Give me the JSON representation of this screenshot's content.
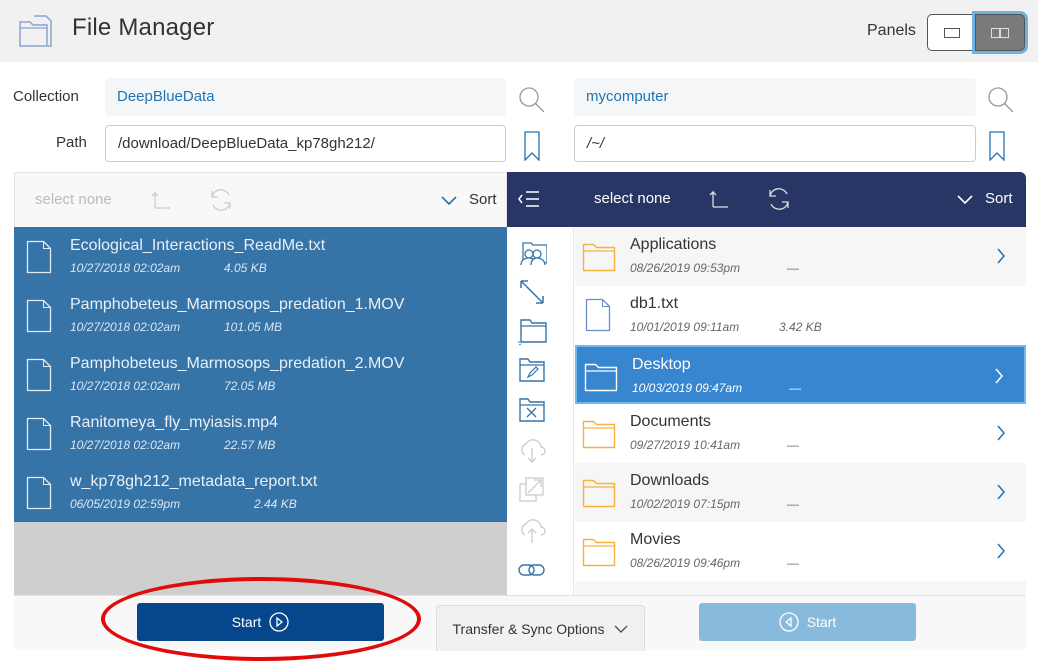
{
  "header": {
    "title": "File Manager",
    "panels_label": "Panels",
    "panel_modes": [
      "single-panel",
      "double-panel"
    ],
    "active_panel_mode": "double-panel"
  },
  "left_panel": {
    "collection_label": "Collection",
    "path_label": "Path",
    "collection": "DeepBlueData",
    "path": "/download/DeepBlueData_kp78gh212/",
    "toolbar": {
      "select_none": "select none",
      "sort": "Sort"
    },
    "items": [
      {
        "name": "Ecological_Interactions_ReadMe.txt",
        "date": "10/27/2018 02:02am",
        "size": "4.05 KB",
        "type": "file",
        "selected": true
      },
      {
        "name": "Pamphobeteus_Marmosops_predation_1.MOV",
        "date": "10/27/2018 02:02am",
        "size": "101.05 MB",
        "type": "file",
        "selected": true
      },
      {
        "name": "Pamphobeteus_Marmosops_predation_2.MOV",
        "date": "10/27/2018 02:02am",
        "size": "72.05 MB",
        "type": "file",
        "selected": true
      },
      {
        "name": "Ranitomeya_fly_myiasis.mp4",
        "date": "10/27/2018 02:02am",
        "size": "22.57 MB",
        "type": "file",
        "selected": true
      },
      {
        "name": "w_kp78gh212_metadata_report.txt",
        "date": "06/05/2019 02:59pm",
        "size": "2.44 KB",
        "type": "file",
        "selected": true
      }
    ]
  },
  "right_panel": {
    "collection": "mycomputer",
    "path": "/~/",
    "toolbar": {
      "select_none": "select none",
      "sort": "Sort"
    },
    "items": [
      {
        "name": "Applications",
        "date": "08/26/2019 09:53pm",
        "size": "—",
        "type": "folder",
        "selected": false
      },
      {
        "name": "db1.txt",
        "date": "10/01/2019 09:11am",
        "size": "3.42 KB",
        "type": "file",
        "selected": false
      },
      {
        "name": "Desktop",
        "date": "10/03/2019 09:47am",
        "size": "—",
        "type": "folder",
        "selected": true
      },
      {
        "name": "Documents",
        "date": "09/27/2019 10:41am",
        "size": "—",
        "type": "folder",
        "selected": false
      },
      {
        "name": "Downloads",
        "date": "10/02/2019 07:15pm",
        "size": "—",
        "type": "folder",
        "selected": false
      },
      {
        "name": "Movies",
        "date": "08/26/2019 09:46pm",
        "size": "—",
        "type": "folder",
        "selected": false
      }
    ]
  },
  "side_actions": [
    "share-icon",
    "rename-arrow-icon",
    "new-folder-icon",
    "edit-folder-icon",
    "delete-folder-icon",
    "download-icon",
    "open-external-icon",
    "upload-icon",
    "link-icon"
  ],
  "bottom": {
    "start_left_label": "Start",
    "options_label": "Transfer & Sync Options",
    "start_right_label": "Start"
  },
  "colors": {
    "selected_row": "#3674a8",
    "dark_toolbar": "#283665",
    "primary_button": "#05468c",
    "disabled_button": "#88bbdb",
    "folder": "#f3b33d",
    "annotation": "#e00b0b"
  }
}
